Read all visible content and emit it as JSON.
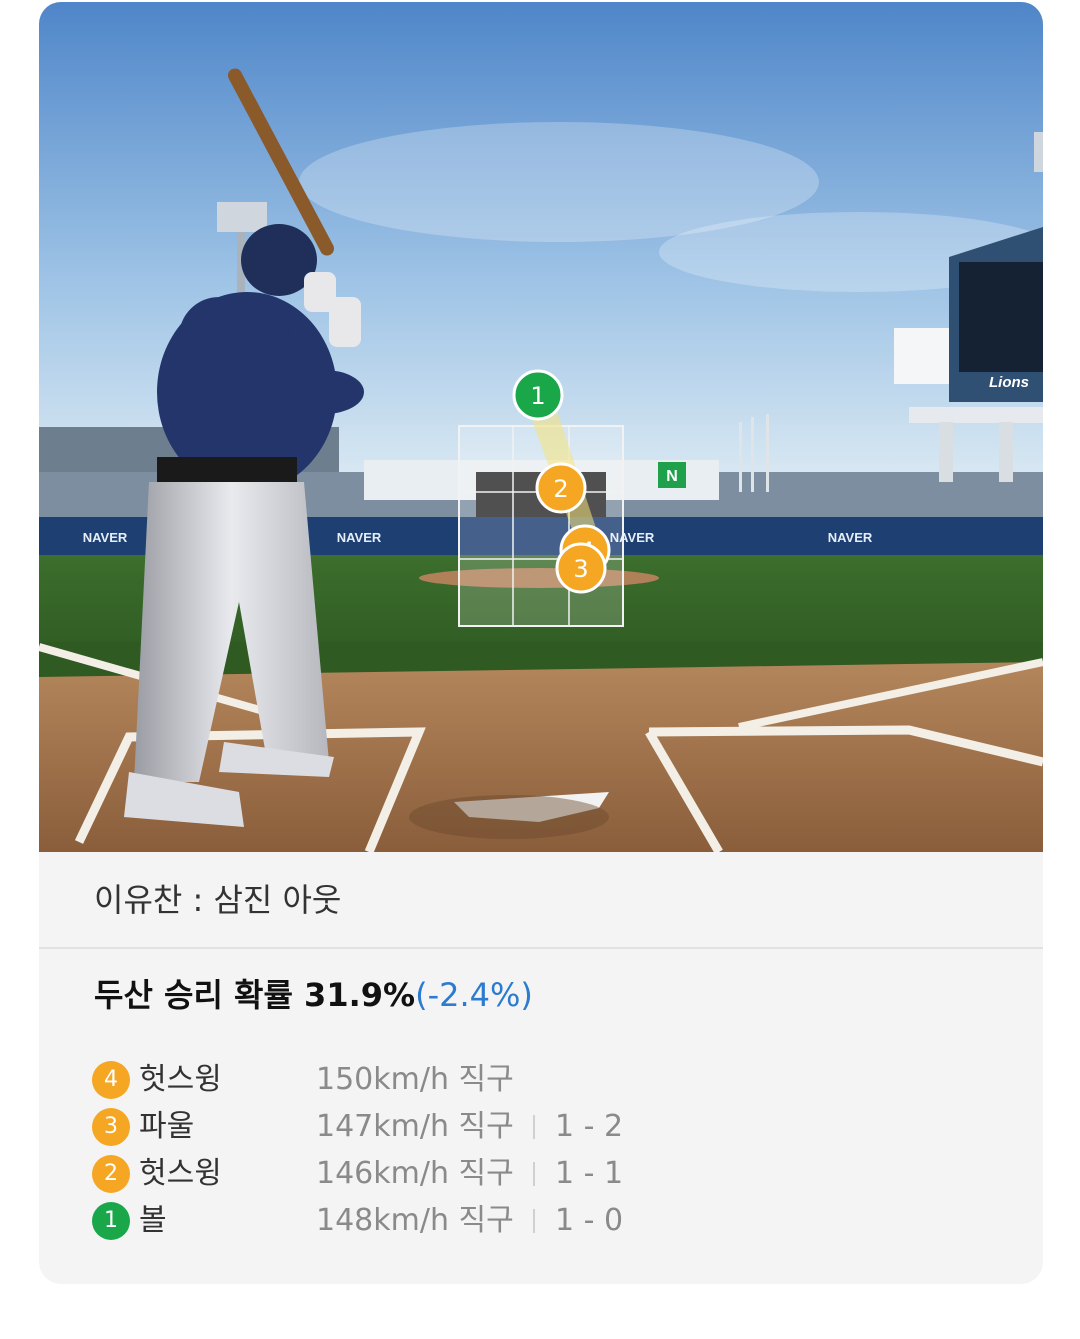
{
  "scene": {
    "banner_words": [
      "NAVER",
      "NAVER",
      "NAVER",
      "NAVER",
      "NAVER"
    ],
    "team_logo_text": "Lions",
    "pitch_markers": [
      {
        "num": "1",
        "result": "ball",
        "color": "#1aa74a"
      },
      {
        "num": "2",
        "result": "strike",
        "color": "#f5a623"
      },
      {
        "num": "3",
        "result": "strike",
        "color": "#f5a623"
      },
      {
        "num": "4",
        "result": "strike",
        "color": "#f5a623"
      }
    ]
  },
  "at_bat": {
    "result_text": "이유찬 : 삼진 아웃"
  },
  "win_prob": {
    "label": "두산 승리 확률 31.9%",
    "delta": "(-2.4%)"
  },
  "pitches": [
    {
      "num": "4",
      "type": "헛스윙",
      "speed": "150km/h  직구",
      "count": "",
      "color": "#f5a623"
    },
    {
      "num": "3",
      "type": "파울",
      "speed": "147km/h  직구",
      "count": "1 - 2",
      "color": "#f5a623"
    },
    {
      "num": "2",
      "type": "헛스윙",
      "speed": "146km/h  직구",
      "count": "1 - 1",
      "color": "#f5a623"
    },
    {
      "num": "1",
      "type": "볼",
      "speed": "148km/h  직구",
      "count": "1 - 0",
      "color": "#1aa74a"
    }
  ]
}
